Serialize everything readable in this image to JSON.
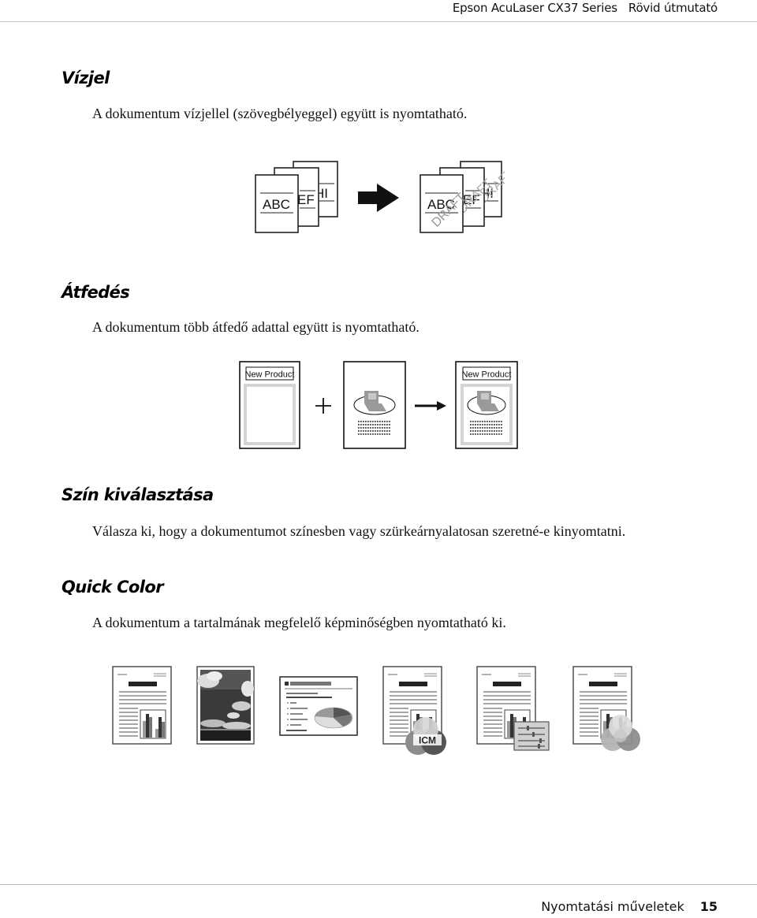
{
  "header": {
    "product": "Epson AcuLaser CX37 Series",
    "guide": "Rövid útmutató"
  },
  "sections": [
    {
      "title": "Vízjel",
      "text": "A dokumentum vízjellel (szövegbélyeggel) együtt is nyomtatható.",
      "figure": {
        "before_pages": [
          "ABC",
          "DEF",
          "GHI"
        ],
        "after_pages": [
          "ABC",
          "DEF",
          "GHI"
        ],
        "watermark": "DRAFT",
        "arrow_icon": "arrow-right-icon"
      }
    },
    {
      "title": "Átfedés",
      "text": "A dokumentum több átfedő adattal együtt is nyomtatható.",
      "figure": {
        "overlay_label": "New Product",
        "result_label": "New Product",
        "plus_icon": "plus-icon",
        "arrow_icon": "arrow-right-icon"
      }
    },
    {
      "title": "Szín kiválasztása",
      "text": "Válasza ki, hogy a dokumentumot színesben vagy szürkeárnyalatosan szeretné-e kinyomtatni."
    },
    {
      "title": "Quick Color",
      "text": "A dokumentum a tartalmának megfelelő képminőségben nyomtatható ki.",
      "figure": {
        "icons": [
          "document-chart-icon",
          "photo-icon",
          "presentation-icon",
          "icm-document-icon",
          "adjust-document-icon",
          "color-circles-document-icon"
        ],
        "icm_label": "ICM"
      }
    }
  ],
  "footer": {
    "section": "Nyomtatási műveletek",
    "page": "15"
  }
}
